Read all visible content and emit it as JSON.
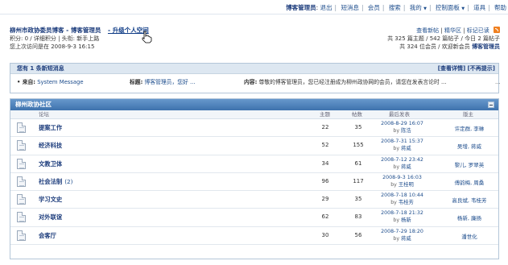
{
  "topbar": {
    "username": "博客管理员",
    "items": [
      "退出",
      "短消息",
      "会员",
      "搜索",
      "我的",
      "控制面板",
      "道具",
      "帮助"
    ]
  },
  "header": {
    "forum_title": "柳州市政协委员博客 - 博客管理员",
    "upgrade_link": "- 升级个人空间",
    "points_line": "积分: 0 / 详细积分 | 头衔: 新手上路",
    "last_visit": "您上次访问是在  2008-9-3 16:15"
  },
  "stats": {
    "links": [
      "查看新帖",
      "精华区",
      "标记已读"
    ],
    "line2": "共 325 篇主题 / 542 篇帖子 / 今日 2 篇帖子",
    "line3_prefix": "共 324 位会员 / 欢迎新会员",
    "new_member": "博客管理员"
  },
  "pm": {
    "title": "您有 1 条新短消息",
    "view_details": "[查看详情]",
    "no_prompt": "[不再提示]",
    "from_label": "来自:",
    "from_value": "System Message",
    "subject_label": "标题:",
    "subject_value": "博客管理员，您好 ...",
    "content_label": "内容:",
    "content_value": "尊敬的博客管理员，您已经注册成为柳州政协网的会员，请您在发表言论时 ...",
    "more": "..."
  },
  "forum": {
    "category": "柳州政协社区",
    "columns": {
      "forum": "论坛",
      "topics": "主题",
      "posts": "帖数",
      "last_post": "最后发表",
      "moderators": "版主"
    },
    "rows": [
      {
        "name": "提案工作",
        "count": "",
        "topics": "22",
        "posts": "35",
        "date": "2008-8-29 16:07",
        "by": "陈浩",
        "mods": "许定群, 李琳"
      },
      {
        "name": "经济科技",
        "count": "",
        "topics": "52",
        "posts": "155",
        "date": "2008-7-31 15:37",
        "by": "蒋威",
        "mods": "吴增, 蒋威"
      },
      {
        "name": "文教卫体",
        "count": "",
        "topics": "34",
        "posts": "61",
        "date": "2008-7-12 23:42",
        "by": "蒋威",
        "mods": "黎儿, 罗翠英"
      },
      {
        "name": "社会法制",
        "count": "(2)",
        "topics": "96",
        "posts": "117",
        "date": "2008-9-3 16:03",
        "by": "王桂明",
        "mods": "傅韵梅, 周桑"
      },
      {
        "name": "学习文史",
        "count": "",
        "topics": "29",
        "posts": "35",
        "date": "2008-7-18 10:44",
        "by": "韦桂芳",
        "mods": "高良斌, 韦桂芳"
      },
      {
        "name": "对外联谊",
        "count": "",
        "topics": "62",
        "posts": "83",
        "date": "2008-7-18 21:32",
        "by": "杨新",
        "mods": "杨新, 廉扬"
      },
      {
        "name": "会客厅",
        "count": "",
        "topics": "30",
        "posts": "56",
        "date": "2008-7-29 18:20",
        "by": "蒋威",
        "mods": "潘世化"
      }
    ]
  }
}
